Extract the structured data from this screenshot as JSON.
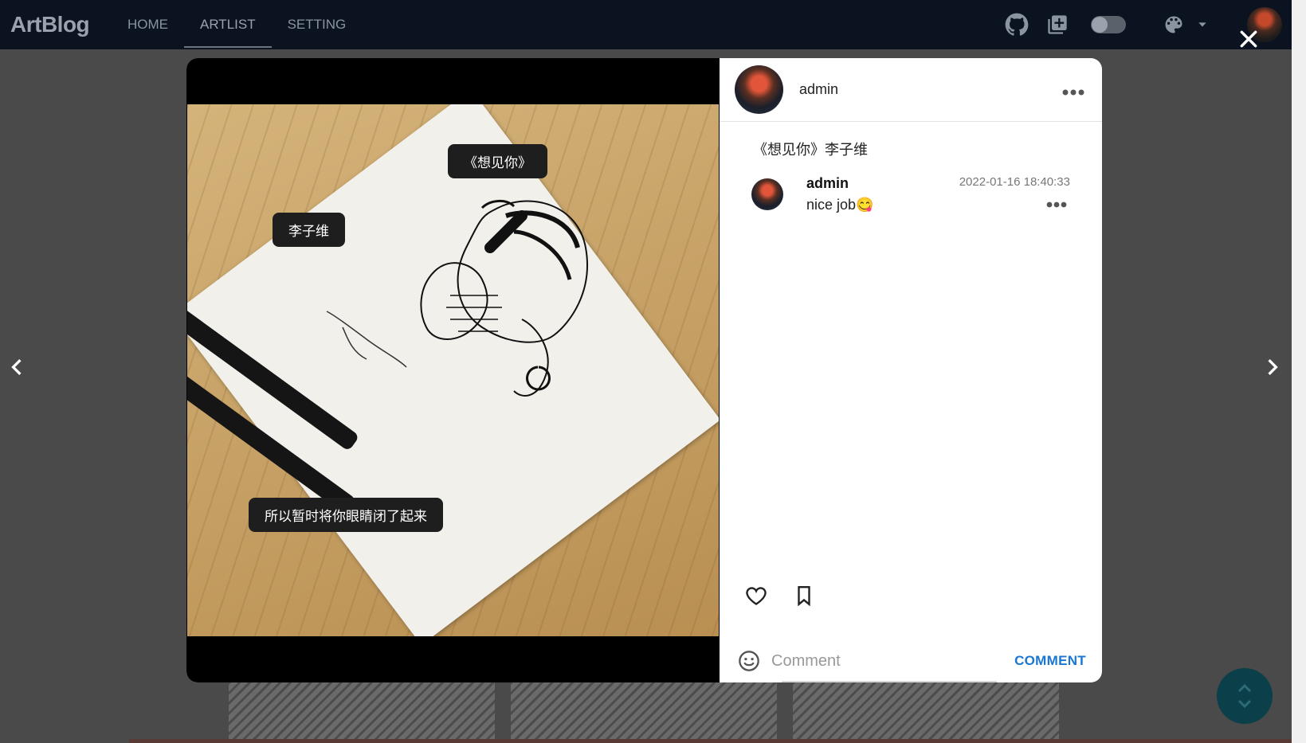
{
  "header": {
    "logo": "ArtBlog",
    "nav": [
      {
        "label": "HOME",
        "active": false
      },
      {
        "label": "ARTLIST",
        "active": true
      },
      {
        "label": "SETTING",
        "active": false
      }
    ],
    "icons": [
      "github-icon",
      "add-box-icon",
      "theme-toggle",
      "palette-icon",
      "chevron-down-icon",
      "avatar"
    ]
  },
  "modal": {
    "close_icon": "close-icon",
    "image_tags": [
      {
        "text": "《想见你》"
      },
      {
        "text": "李子维"
      },
      {
        "text": "所以暂时将你眼睛闭了起来"
      }
    ],
    "post": {
      "author": "admin",
      "caption": "《想见你》李子维",
      "more_icon": "more-icon"
    },
    "comments": [
      {
        "user": "admin",
        "text": "nice job😋",
        "time": "2022-01-16 18:40:33"
      }
    ],
    "actions": {
      "like_icon": "heart-outline-icon",
      "bookmark_icon": "bookmark-outline-icon"
    },
    "comment_input": {
      "placeholder": "Comment",
      "button_label": "COMMENT",
      "emoji_icon": "emoji-icon"
    }
  },
  "navigation": {
    "prev_icon": "chevron-left-icon",
    "next_icon": "chevron-right-icon",
    "scroll_top_icon": "scroll-arrows-icon"
  },
  "colors": {
    "topbar": "#0b1220",
    "accent": "#1976d2",
    "fab": "#0b3f49",
    "overlay": "#4a4a4a"
  }
}
